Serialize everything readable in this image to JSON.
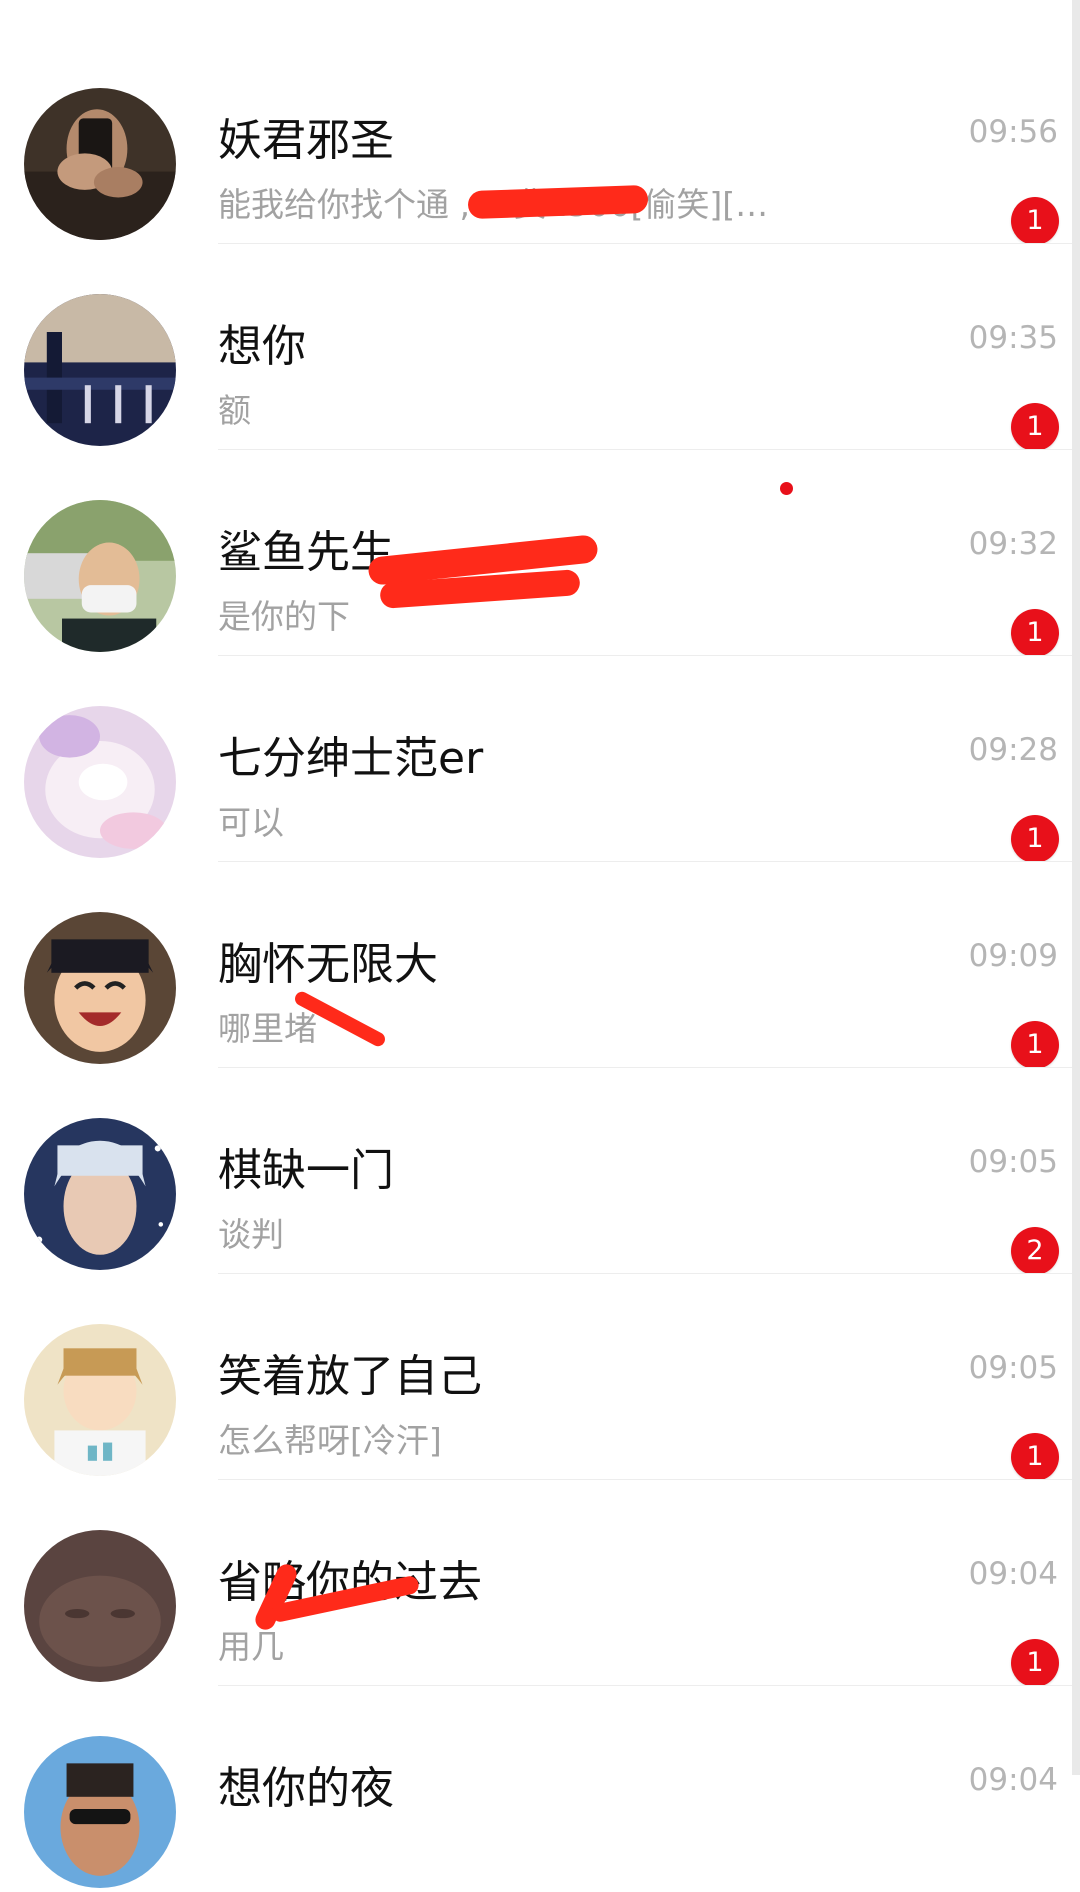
{
  "colors": {
    "badge": "#e8101a",
    "name_text": "#111111",
    "preview_text": "#a2a2a2",
    "time_text": "#b5b5b5",
    "background": "#ffffff"
  },
  "conversations": [
    {
      "name": "妖君邪圣",
      "preview": "能我给你找个通           , 工费1500[偷笑][…",
      "time": "09:56",
      "unread": "1",
      "avatar_icon": "avatar-hands-phone"
    },
    {
      "name": "想你",
      "preview": "额",
      "time": "09:35",
      "unread": "1",
      "avatar_icon": "avatar-night-bridge"
    },
    {
      "name": "鲨鱼先生",
      "preview": "是你的下",
      "time": "09:32",
      "unread": "1",
      "avatar_icon": "avatar-masked-man"
    },
    {
      "name": "七分绅士范er",
      "preview": "可以",
      "time": "09:28",
      "unread": "1",
      "avatar_icon": "avatar-pastel-plush"
    },
    {
      "name": "胸怀无限大",
      "preview": "哪里堵",
      "time": "09:09",
      "unread": "1",
      "avatar_icon": "avatar-anime-laughing"
    },
    {
      "name": "棋缺一门",
      "preview": "谈判",
      "time": "09:05",
      "unread": "2",
      "avatar_icon": "avatar-silver-hair"
    },
    {
      "name": "笑着放了自己",
      "preview": "怎么帮呀[冷汗]",
      "time": "09:05",
      "unread": "1",
      "avatar_icon": "avatar-anime-boy"
    },
    {
      "name": "省略你的过去",
      "preview": "用几",
      "time": "09:04",
      "unread": "1",
      "avatar_icon": "avatar-dark-blurry"
    },
    {
      "name": "想你的夜",
      "preview": "",
      "time": "09:04",
      "unread": "",
      "avatar_icon": "avatar-sunglasses"
    }
  ]
}
